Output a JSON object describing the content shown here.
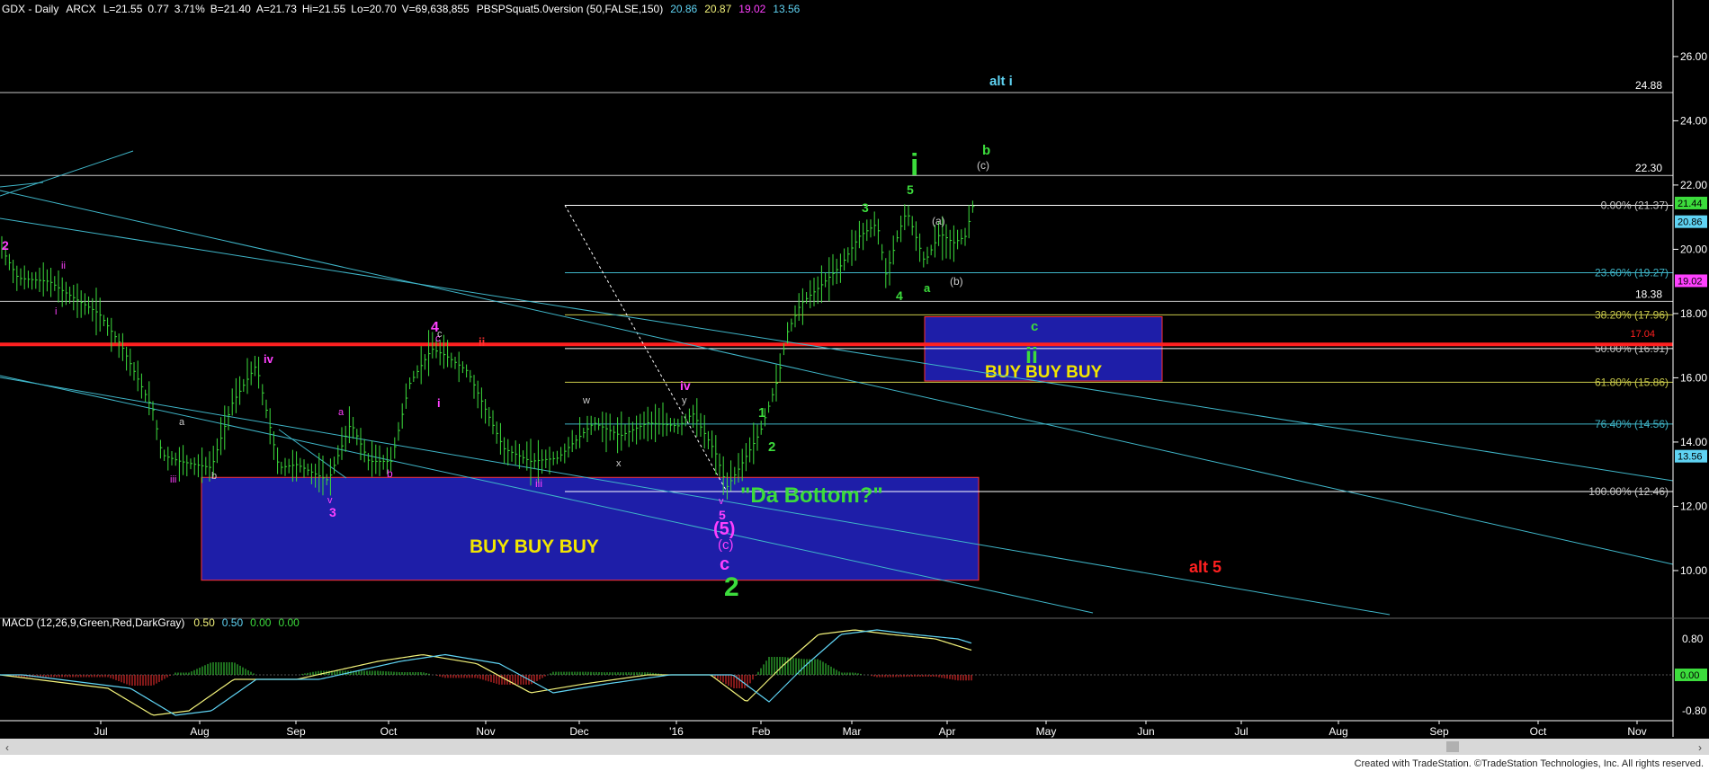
{
  "header": {
    "symbol": "GDX - Daily",
    "exchange": "ARCX",
    "last": "L=21.55",
    "change": "0.77",
    "pct_change": "3.71%",
    "bid": "B=21.40",
    "ask": "A=21.73",
    "hi": "Hi=21.55",
    "lo": "Lo=20.70",
    "volume": "V=69,638,855",
    "indicator_name": "PBSPSquat5.0version (50,FALSE,150)",
    "indicator_values": [
      "20.86",
      "20.87",
      "19.02",
      "13.56"
    ],
    "indicator_colors": [
      "#5fd3f3",
      "#f2f27a",
      "#ff40ff",
      "#5fd3f3"
    ]
  },
  "macd_header": {
    "label": "MACD (12,26,9,Green,Red,DarkGray)",
    "values": [
      "0.50",
      "0.50",
      "0.00",
      "0.00"
    ],
    "colors": [
      "#f2f27a",
      "#5fd3f3",
      "#3cdc3c",
      "#3cdc3c"
    ]
  },
  "colors": {
    "background": "#000000",
    "axis": "#ffffff",
    "channel": "#3fb5c8",
    "resistance": "#ff2020",
    "fib": "#ffffff",
    "box_fill": "#1e1ea8",
    "box_border": "#ff3030",
    "up_bar": "#3cdc3c",
    "down_bar": "#3cdc3c"
  },
  "footer": "Created with TradeStation. ©TradeStation Technologies, Inc. All rights reserved.",
  "chart_data": {
    "type": "line",
    "title": "GDX - Daily",
    "y_axis": {
      "min": 8.6,
      "max": 27.2,
      "ticks": [
        "10.00",
        "12.00",
        "14.00",
        "16.00",
        "18.00",
        "20.00",
        "22.00",
        "24.00",
        "26.00"
      ]
    },
    "x_axis": {
      "labels": [
        "Jul",
        "Aug",
        "Sep",
        "Oct",
        "Nov",
        "Dec",
        "'16",
        "Feb",
        "Mar",
        "Apr",
        "May",
        "Jun",
        "Jul",
        "Aug",
        "Sep",
        "Oct",
        "Nov"
      ]
    },
    "price_markers": [
      {
        "text": "21.44",
        "value": 21.44,
        "bg": "#3cdc3c",
        "fg": "#000"
      },
      {
        "text": "20.86",
        "value": 20.86,
        "bg": "#5fd3f3",
        "fg": "#000"
      },
      {
        "text": "19.02",
        "value": 19.02,
        "bg": "#ff40ff",
        "fg": "#000"
      },
      {
        "text": "13.56",
        "value": 13.56,
        "bg": "#5fd3f3",
        "fg": "#000"
      }
    ],
    "levels": [
      {
        "label": "24.88",
        "value": 24.88
      },
      {
        "label": "22.30",
        "value": 22.3
      },
      {
        "label": "18.38",
        "value": 18.38
      }
    ],
    "fib_levels": [
      {
        "label": "0.00% (21.37)",
        "value": 21.37
      },
      {
        "label": "23.60% (19.27)",
        "value": 19.27
      },
      {
        "label": "38.20% (17.96)",
        "value": 17.96
      },
      {
        "label": "50.00% (16.91)",
        "value": 16.91
      },
      {
        "label": "61.80% (15.86)",
        "value": 15.86
      },
      {
        "label": "76.40% (14.56)",
        "value": 14.56
      },
      {
        "label": "100.00% (12.46)",
        "value": 12.46
      }
    ],
    "resistance": {
      "label": "17.04",
      "value": 17.04
    },
    "boxes": [
      {
        "label": "BUY BUY BUY",
        "top": 12.9,
        "bottom": 9.7
      },
      {
        "label": "BUY  BUY   BUY",
        "top": 17.9,
        "bottom": 15.9
      }
    ],
    "annotations": [
      {
        "text": "alt i",
        "color": "#5fd3f3"
      },
      {
        "text": "i",
        "color": "#3cdc3c"
      },
      {
        "text": "b",
        "color": "#3cdc3c"
      },
      {
        "text": "(c)",
        "color": "#cccccc"
      },
      {
        "text": "5",
        "color": "#3cdc3c"
      },
      {
        "text": "3",
        "color": "#3cdc3c"
      },
      {
        "text": "(a)",
        "color": "#cccccc"
      },
      {
        "text": "(b)",
        "color": "#cccccc"
      },
      {
        "text": "a",
        "color": "#3cdc3c"
      },
      {
        "text": "4",
        "color": "#3cdc3c"
      },
      {
        "text": "c",
        "color": "#3cdc3c"
      },
      {
        "text": "ii",
        "color": "#3cdc3c"
      },
      {
        "text": "1",
        "color": "#3cdc3c"
      },
      {
        "text": "2",
        "color": "#3cdc3c"
      },
      {
        "text": "\"Da Bottom?\"",
        "color": "#3cdc3c"
      },
      {
        "text": "2",
        "color": "#ff40ff"
      },
      {
        "text": "ii",
        "color": "#ff40ff"
      },
      {
        "text": "i",
        "color": "#ff40ff"
      },
      {
        "text": "4",
        "color": "#ff40ff"
      },
      {
        "text": "c",
        "color": "#ff40ff"
      },
      {
        "text": "ii",
        "color": "#ff3030"
      },
      {
        "text": "i",
        "color": "#ff40ff"
      },
      {
        "text": "iv",
        "color": "#ff40ff"
      },
      {
        "text": "c",
        "color": "#cccccc"
      },
      {
        "text": "a",
        "color": "#cccccc"
      },
      {
        "text": "a",
        "color": "#ff40ff"
      },
      {
        "text": "iii",
        "color": "#ff40ff"
      },
      {
        "text": "b",
        "color": "#cccccc"
      },
      {
        "text": "v",
        "color": "#ff40ff"
      },
      {
        "text": "3",
        "color": "#ff40ff"
      },
      {
        "text": "b",
        "color": "#ff40ff"
      },
      {
        "text": "iii",
        "color": "#ff40ff"
      },
      {
        "text": "w",
        "color": "#cccccc"
      },
      {
        "text": "x",
        "color": "#cccccc"
      },
      {
        "text": "y",
        "color": "#cccccc"
      },
      {
        "text": "iv",
        "color": "#ff40ff"
      },
      {
        "text": "v",
        "color": "#ff40ff"
      },
      {
        "text": "5",
        "color": "#ff40ff"
      },
      {
        "text": "(5)",
        "color": "#ff40ff"
      },
      {
        "text": "(c)",
        "color": "#ff40ff"
      },
      {
        "text": "c",
        "color": "#ff40ff"
      },
      {
        "text": "2",
        "color": "#3cdc3c"
      },
      {
        "text": "alt 5",
        "color": "#ff2020"
      }
    ],
    "macd_ticks": [
      "0.80",
      "0.00",
      "-0.80"
    ],
    "macd_marker": {
      "text": "0.00",
      "bg": "#3cdc3c"
    }
  }
}
